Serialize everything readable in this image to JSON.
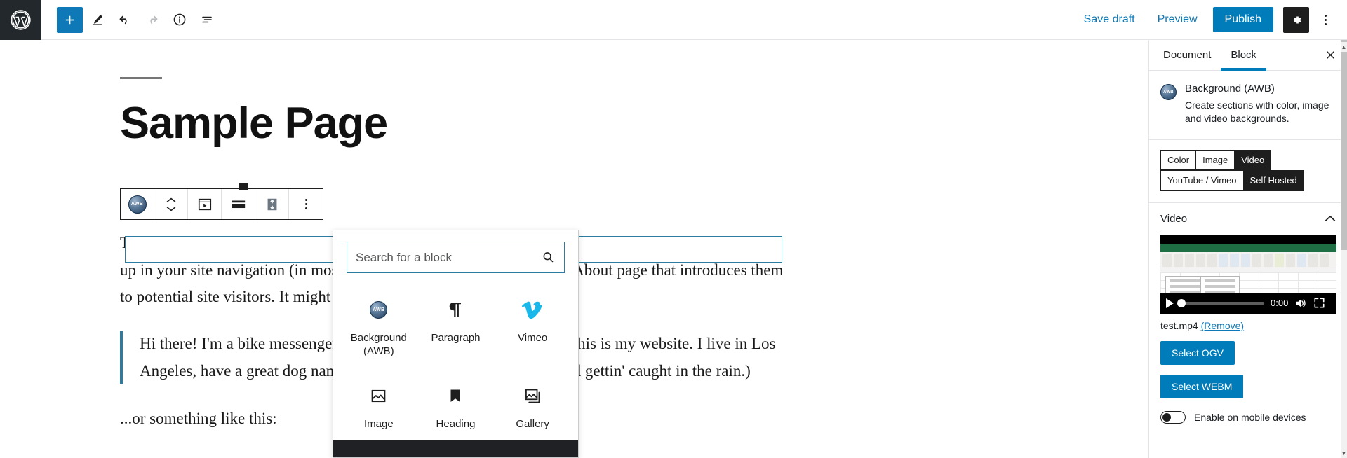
{
  "topbar": {
    "logo_icon": "wordpress-logo",
    "tools": [
      {
        "name": "add-block-button",
        "icon": "plus-icon",
        "label": "+"
      },
      {
        "name": "edit-mode-button",
        "icon": "pencil-icon",
        "label": ""
      },
      {
        "name": "undo-button",
        "icon": "undo-arrow-icon",
        "label": ""
      },
      {
        "name": "redo-button",
        "icon": "redo-arrow-icon",
        "label": ""
      },
      {
        "name": "content-info-button",
        "icon": "info-circle-icon",
        "label": ""
      },
      {
        "name": "block-navigation-button",
        "icon": "list-view-icon",
        "label": ""
      }
    ],
    "save_draft_label": "Save draft",
    "preview_label": "Preview",
    "publish_label": "Publish",
    "settings_icon": "gear-icon",
    "more_icon": "ellipsis-vertical-icon",
    "accent_color": "#007cba",
    "logo_bg": "#23282d"
  },
  "editor": {
    "page_title": "Sample Page",
    "paragraph_1": "This is an example page. It's different from a blog post because it will stay in one place and will show up in your site navigation (in most themes). Most people start with an About page that introduces them to potential site visitors. It might say something like this:",
    "quote": "Hi there! I'm a bike messenger by day, aspiring actor by night, and this is my website. I live in Los Angeles, have a great dog named Jack, and I like piña coladas. (And gettin' caught in the rain.)",
    "after_quote": "...or something like this:",
    "empty_block_plus": "+",
    "block_toolbar": [
      {
        "name": "block-type-awb-button",
        "icon": "awb-badge-icon",
        "label": "AWB"
      },
      {
        "name": "move-block-button",
        "icon": "chevron-up-down-icon",
        "label": ""
      },
      {
        "name": "video-background-button",
        "icon": "video-frame-icon",
        "label": ""
      },
      {
        "name": "align-full-button",
        "icon": "align-full-width-icon",
        "label": ""
      },
      {
        "name": "vertical-align-button",
        "icon": "vertical-align-icon",
        "label": ""
      },
      {
        "name": "block-options-button",
        "icon": "ellipsis-vertical-icon",
        "label": ""
      }
    ]
  },
  "inserter": {
    "search_placeholder": "Search for a block",
    "search_value": "",
    "search_icon": "magnifier-icon",
    "blocks": [
      {
        "label": "Background (AWB)",
        "icon": "awb-badge-icon"
      },
      {
        "label": "Paragraph",
        "icon": "pilcrow-icon"
      },
      {
        "label": "Vimeo",
        "icon": "vimeo-logo-icon"
      },
      {
        "label": "Image",
        "icon": "image-icon"
      },
      {
        "label": "Heading",
        "icon": "heading-bookmark-icon"
      },
      {
        "label": "Gallery",
        "icon": "gallery-icon"
      }
    ]
  },
  "sidebar": {
    "tabs": [
      {
        "label": "Document",
        "active": false
      },
      {
        "label": "Block",
        "active": true
      }
    ],
    "close_icon": "close-x-icon",
    "block": {
      "icon": "awb-badge-icon",
      "badge_text": "AWB",
      "title": "Background (AWB)",
      "description": "Create sections with color, image and video backgrounds."
    },
    "type_group": [
      {
        "label": "Color",
        "active": false
      },
      {
        "label": "Image",
        "active": false
      },
      {
        "label": "Video",
        "active": true
      }
    ],
    "source_group": [
      {
        "label": "YouTube / Vimeo",
        "active": false
      },
      {
        "label": "Self Hosted",
        "active": true
      }
    ],
    "video_section": {
      "title": "Video",
      "collapse_icon": "chevron-up-icon",
      "player": {
        "play_icon": "play-triangle-icon",
        "time": "0:00",
        "volume_icon": "speaker-icon",
        "fullscreen_icon": "expand-arrows-icon"
      },
      "file_name": "test.mp4",
      "remove_label": "(Remove)",
      "select_ogv_label": "Select OGV",
      "select_webm_label": "Select WEBM",
      "mobile_toggle_label": "Enable on mobile devices",
      "mobile_toggle_on": false
    }
  }
}
